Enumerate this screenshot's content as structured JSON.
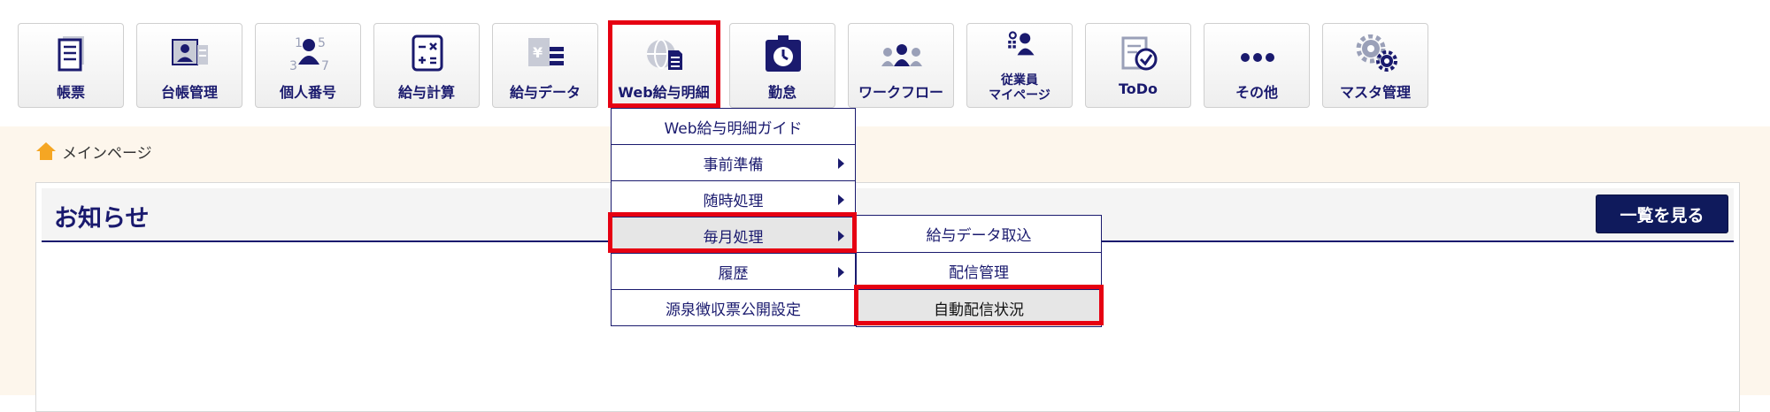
{
  "toolbar": {
    "buttons": [
      {
        "label": "帳票",
        "icon": "report-icon"
      },
      {
        "label": "台帳管理",
        "icon": "ledger-icon"
      },
      {
        "label": "個人番号",
        "icon": "personal-number-icon"
      },
      {
        "label": "給与計算",
        "icon": "calculator-icon"
      },
      {
        "label": "給与データ",
        "icon": "payroll-data-icon"
      },
      {
        "label": "Web給与明細",
        "icon": "web-payslip-icon"
      },
      {
        "label": "勤怠",
        "icon": "attendance-icon"
      },
      {
        "label": "ワークフロー",
        "icon": "workflow-icon"
      },
      {
        "label_line1": "従業員",
        "label_line2": "マイページ",
        "icon": "employee-mypage-icon"
      },
      {
        "label": "ToDo",
        "icon": "todo-icon"
      },
      {
        "label": "その他",
        "icon": "more-icon"
      },
      {
        "label": "マスタ管理",
        "icon": "master-settings-icon"
      }
    ]
  },
  "breadcrumb": {
    "home_label": "メインページ"
  },
  "notice": {
    "title": "お知らせ",
    "view_all_label": "一覧を見る"
  },
  "menu": {
    "items": [
      {
        "label": "Web給与明細ガイド"
      },
      {
        "label": "事前準備"
      },
      {
        "label": "随時処理"
      },
      {
        "label": "毎月処理"
      },
      {
        "label": "履歴"
      },
      {
        "label": "源泉徴収票公開設定"
      }
    ]
  },
  "submenu": {
    "items": [
      {
        "label": "給与データ取込"
      },
      {
        "label": "配信管理"
      },
      {
        "label": "自動配信状況"
      }
    ]
  },
  "colors": {
    "accent": "#1a1a6e",
    "highlight": "#e60012",
    "button_dark": "#0f1a5c",
    "content_bg": "#fdf6ec"
  }
}
